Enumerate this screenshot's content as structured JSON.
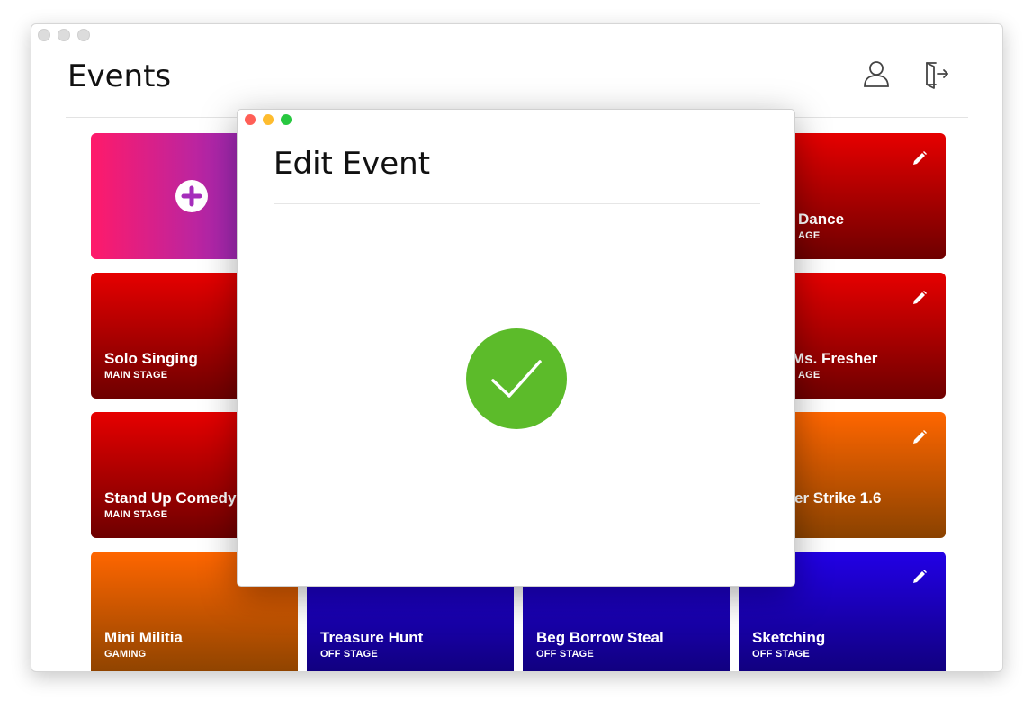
{
  "page": {
    "title": "Events"
  },
  "header": {
    "icons": [
      "profile-icon",
      "logout-icon"
    ]
  },
  "events": [
    {
      "name": "Solo Singing",
      "category": "MAIN STAGE",
      "theme": "red"
    },
    {
      "name": "Stand Up Comedy",
      "category": "MAIN STAGE",
      "theme": "red"
    },
    {
      "name": "Mini Militia",
      "category": "GAMING",
      "theme": "orange"
    },
    {
      "name": "Treasure Hunt",
      "category": "OFF STAGE",
      "theme": "blue"
    },
    {
      "name": "Beg Borrow Steal",
      "category": "OFF STAGE",
      "theme": "blue"
    },
    {
      "name": "Sketching",
      "category": "OFF STAGE",
      "theme": "blue"
    },
    {
      "name": "Dance",
      "category": "AGE",
      "theme": "red"
    },
    {
      "name": "Ms. Fresher",
      "category": "AGE",
      "theme": "red"
    },
    {
      "name": "er Strike 1.6",
      "category": "",
      "theme": "orange"
    }
  ],
  "dialog": {
    "title": "Edit Event",
    "status_icon": "checkmark-success-icon"
  },
  "colors": {
    "card_red": "#e60000",
    "card_orange": "#ff6600",
    "card_blue": "#2200e6",
    "add_gradient_start": "#ff1a6a",
    "add_gradient_end": "#7a2fd4",
    "success_green": "#5cbb2a"
  }
}
